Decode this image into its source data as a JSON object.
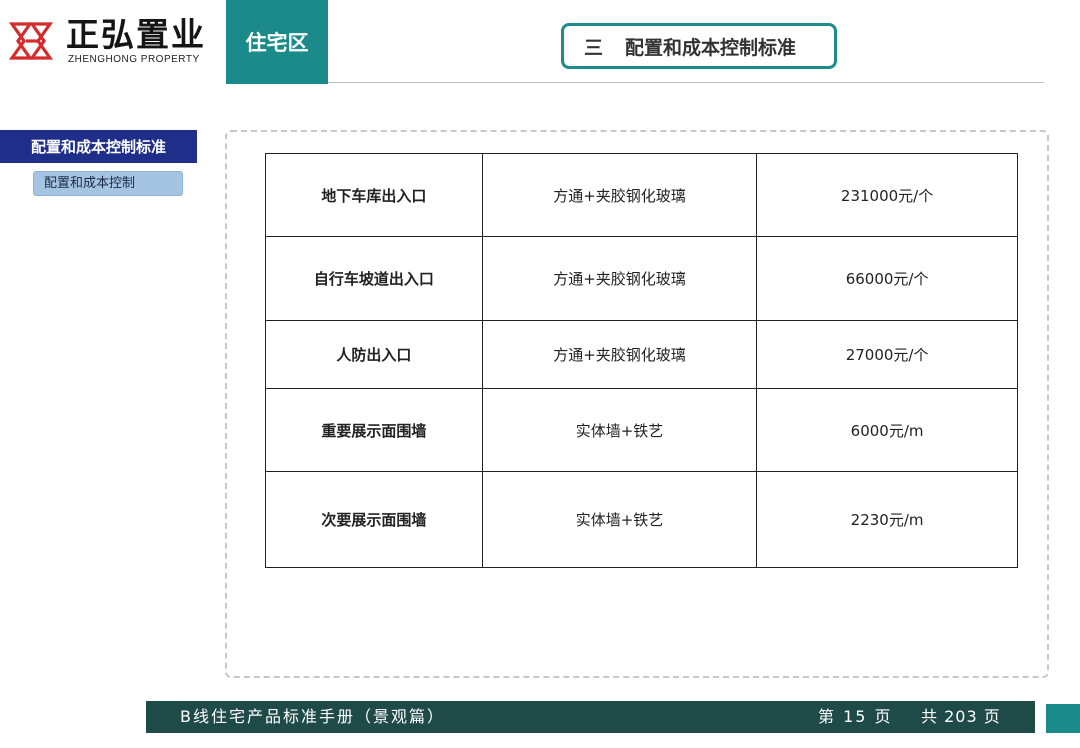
{
  "brand": {
    "name_cn": "正弘置业",
    "name_en": "ZHENGHONG PROPERTY",
    "accent_color": "#1a8a8a"
  },
  "section_tab": "住宅区",
  "header": {
    "number": "三",
    "title": "配置和成本控制标准"
  },
  "sidebar": {
    "main_item": "配置和成本控制标准",
    "sub_item": "配置和成本控制"
  },
  "table": {
    "rows": [
      {
        "name": "地下车库出入口",
        "material": "方通+夹胶钢化玻璃",
        "price": "231000元/个"
      },
      {
        "name": "自行车坡道出入口",
        "material": "方通+夹胶钢化玻璃",
        "price": "66000元/个"
      },
      {
        "name": "人防出入口",
        "material": "方通+夹胶钢化玻璃",
        "price": "27000元/个"
      },
      {
        "name": "重要展示面围墙",
        "material": "实体墙+铁艺",
        "price": "6000元/m"
      },
      {
        "name": "次要展示面围墙",
        "material": "实体墙+铁艺",
        "price": "2230元/m"
      }
    ]
  },
  "footer": {
    "title": "B线住宅产品标准手册（景观篇）",
    "page_label": "第 15 页",
    "total_label": "共 203 页"
  }
}
